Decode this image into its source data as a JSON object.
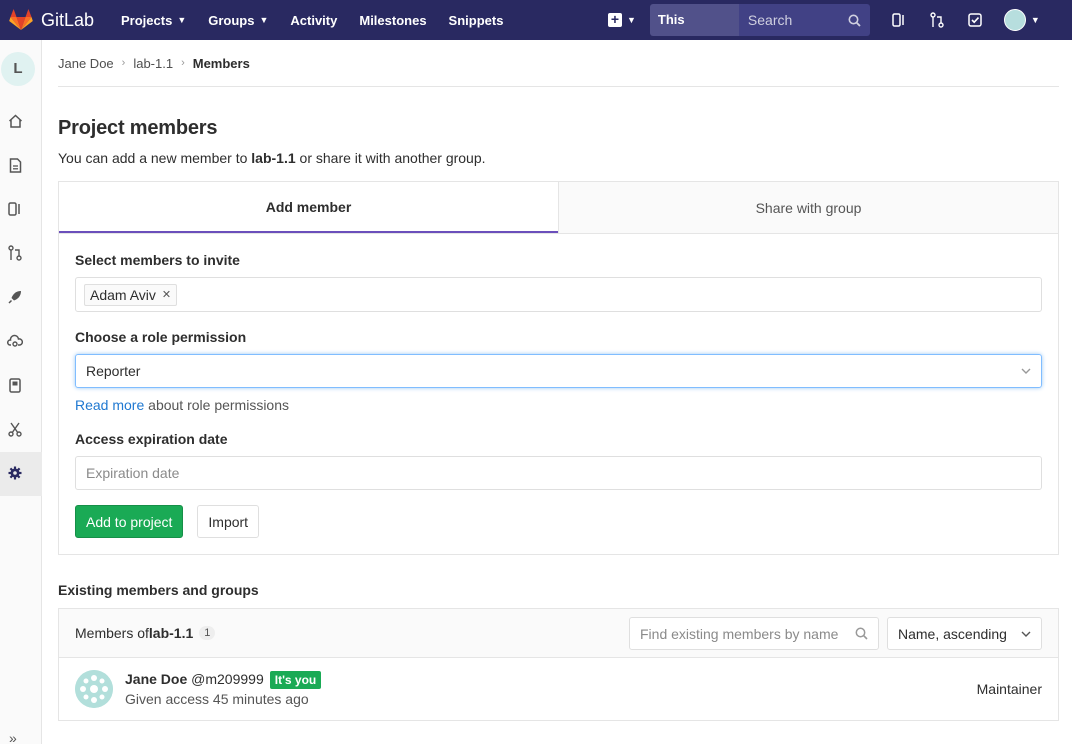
{
  "topbar": {
    "brand": "GitLab",
    "nav": [
      {
        "label": "Projects",
        "dropdown": true
      },
      {
        "label": "Groups",
        "dropdown": true
      },
      {
        "label": "Activity",
        "dropdown": false
      },
      {
        "label": "Milestones",
        "dropdown": false
      },
      {
        "label": "Snippets",
        "dropdown": false
      }
    ],
    "search_scope": "This project",
    "search_placeholder": "Search"
  },
  "sidebar": {
    "project_initial": "L"
  },
  "breadcrumb": [
    "Jane Doe",
    "lab-1.1",
    "Members"
  ],
  "page": {
    "title": "Project members",
    "intro_prefix": "You can add a new member to ",
    "intro_project": "lab-1.1",
    "intro_suffix": " or share it with another group."
  },
  "tabs": [
    "Add member",
    "Share with group"
  ],
  "form": {
    "select_label": "Select members to invite",
    "selected_member": "Adam Aviv",
    "role_label": "Choose a role permission",
    "role_value": "Reporter",
    "help_link": "Read more",
    "help_text": " about role permissions",
    "expiration_label": "Access expiration date",
    "expiration_placeholder": "Expiration date",
    "submit_label": "Add to project",
    "import_label": "Import"
  },
  "existing": {
    "title": "Existing members and groups",
    "members_of_prefix": "Members of ",
    "project": "lab-1.1",
    "count": "1",
    "find_placeholder": "Find existing members by name",
    "sort_label": "Name, ascending",
    "members": [
      {
        "name": "Jane Doe",
        "username": "@m209999",
        "badge": "It's you",
        "access": "Given access 45 minutes ago",
        "role": "Maintainer"
      }
    ]
  },
  "colors": {
    "header": "#292961",
    "accent_tab": "#6b4fbb",
    "success": "#1aaa55",
    "link": "#1f78d1"
  }
}
